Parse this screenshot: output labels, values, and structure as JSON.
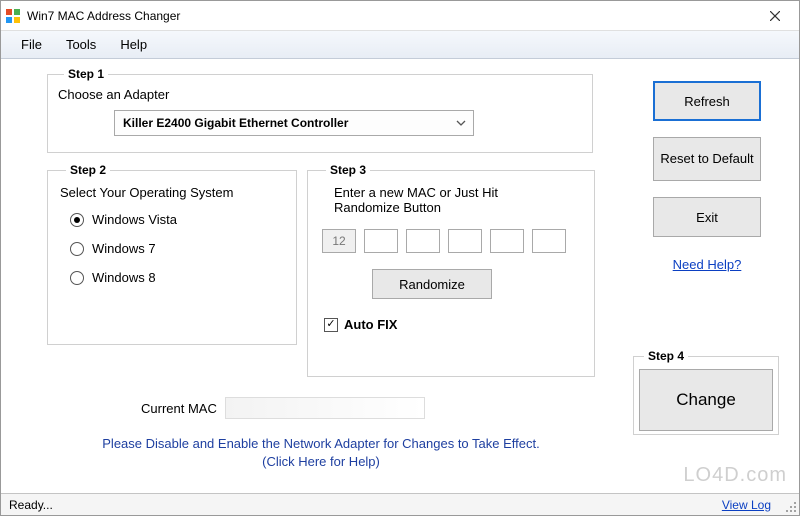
{
  "window": {
    "title": "Win7 MAC Address Changer"
  },
  "menu": {
    "file": "File",
    "tools": "Tools",
    "help": "Help"
  },
  "step1": {
    "legend": "Step 1",
    "label": "Choose an Adapter",
    "selected": "Killer E2400 Gigabit Ethernet Controller"
  },
  "step2": {
    "legend": "Step 2",
    "label": "Select Your Operating System",
    "options": {
      "vista": "Windows Vista",
      "win7": "Windows 7",
      "win8": "Windows 8"
    },
    "selected": "vista"
  },
  "step3": {
    "legend": "Step 3",
    "label": "Enter a new MAC or Just Hit Randomize Button",
    "mac": [
      "12",
      "",
      "",
      "",
      "",
      ""
    ],
    "randomize": "Randomize",
    "autofix_label": "Auto FIX",
    "autofix_checked": true
  },
  "step4": {
    "legend": "Step 4",
    "change": "Change"
  },
  "sidebuttons": {
    "refresh": "Refresh",
    "reset": "Reset to Default",
    "exit": "Exit",
    "help": "Need Help?"
  },
  "current_mac": {
    "label": "Current MAC",
    "value": ""
  },
  "hint": {
    "line1": "Please Disable and Enable the Network Adapter for Changes to Take Effect.",
    "line2": "(Click Here for Help)"
  },
  "status": {
    "text": "Ready...",
    "viewlog": "View Log"
  },
  "watermark": "LO4D.com"
}
